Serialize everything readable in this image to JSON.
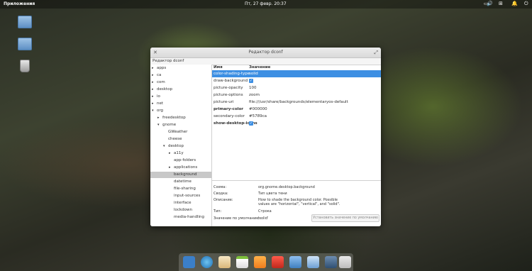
{
  "panel": {
    "applications": "Приложения",
    "clock": "Пт, 27 февр. 20:37"
  },
  "window": {
    "title": "Редактор dconf",
    "path": "Редактор dconf"
  },
  "tree": [
    {
      "label": "apps",
      "arrow": "▸"
    },
    {
      "label": "ca",
      "arrow": "▸"
    },
    {
      "label": "com",
      "arrow": "▸"
    },
    {
      "label": "desktop",
      "arrow": "▸"
    },
    {
      "label": "io",
      "arrow": "▸"
    },
    {
      "label": "net",
      "arrow": "▸"
    },
    {
      "label": "org",
      "arrow": "▾"
    },
    {
      "label": "freedesktop",
      "arrow": "▸"
    },
    {
      "label": "gnome",
      "arrow": "▾"
    },
    {
      "label": "GWeather",
      "arrow": ""
    },
    {
      "label": "cheese",
      "arrow": ""
    },
    {
      "label": "desktop",
      "arrow": "▾"
    },
    {
      "label": "a11y",
      "arrow": "▸"
    },
    {
      "label": "app-folders",
      "arrow": ""
    },
    {
      "label": "applications",
      "arrow": "▸"
    },
    {
      "label": "background",
      "arrow": ""
    },
    {
      "label": "datetime",
      "arrow": ""
    },
    {
      "label": "file-sharing",
      "arrow": ""
    },
    {
      "label": "input-sources",
      "arrow": ""
    },
    {
      "label": "interface",
      "arrow": ""
    },
    {
      "label": "lockdown",
      "arrow": ""
    },
    {
      "label": "media-handling",
      "arrow": ""
    }
  ],
  "keys": {
    "col_name": "Имя",
    "col_value": "Значение",
    "rows": [
      {
        "name": "color-shading-type",
        "value": "solid"
      },
      {
        "name": "draw-background",
        "value": ""
      },
      {
        "name": "picture-opacity",
        "value": "100"
      },
      {
        "name": "picture-options",
        "value": "zoom"
      },
      {
        "name": "picture-uri",
        "value": "file:///usr/share/backgrounds/elementaryos-default"
      },
      {
        "name": "primary-color",
        "value": "#000000"
      },
      {
        "name": "secondary-color",
        "value": "#5789ca"
      },
      {
        "name": "show-desktop-icons",
        "value": ""
      }
    ]
  },
  "info": {
    "schema_label": "Схема:",
    "schema_value": "org.gnome.desktop.background",
    "summary_label": "Сводка:",
    "summary_value": "Тип цвета тени",
    "description_label": "Описание:",
    "description_value": "How to shade the background color. Possible values are \"horizontal\", \"vertical\", and \"solid\".",
    "type_label": "Тип:",
    "type_value": "Строка",
    "default_label": "Значение по умолчанию:",
    "default_value": "'solid'",
    "default_button": "Установить значение по умолчанию"
  }
}
